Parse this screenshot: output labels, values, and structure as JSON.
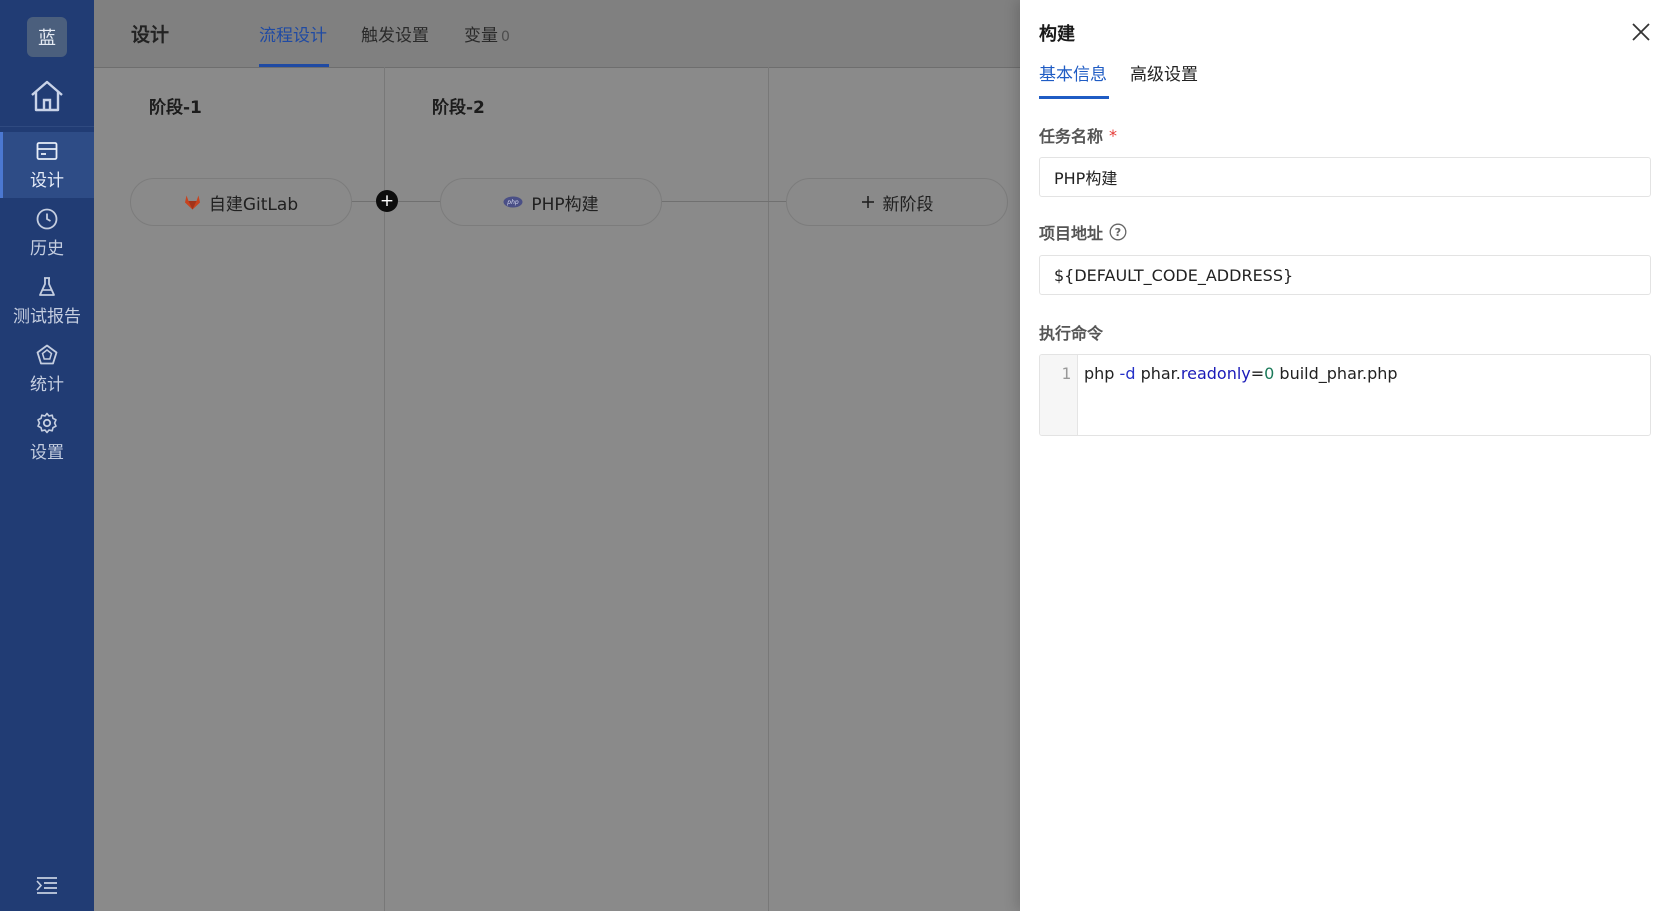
{
  "app": {
    "logo_text": "蓝"
  },
  "sidebar": {
    "items": [
      {
        "label": "设计",
        "icon": "card-icon",
        "active": true
      },
      {
        "label": "历史",
        "icon": "clock-icon",
        "active": false
      },
      {
        "label": "测试报告",
        "icon": "flask-icon",
        "active": false
      },
      {
        "label": "统计",
        "icon": "pentagon-chart-icon",
        "active": false
      },
      {
        "label": "设置",
        "icon": "gear-icon",
        "active": false
      }
    ]
  },
  "main": {
    "title": "设计",
    "tabs": [
      {
        "label": "流程设计",
        "active": true
      },
      {
        "label": "触发设置",
        "active": false
      },
      {
        "label": "变量",
        "count": "0",
        "active": false
      }
    ],
    "stages": [
      {
        "title": "阶段-1",
        "task": "自建GitLab",
        "icon": "gitlab-icon"
      },
      {
        "title": "阶段-2",
        "task": "PHP构建",
        "icon": "php-icon"
      }
    ],
    "new_stage_label": "新阶段"
  },
  "drawer": {
    "title": "构建",
    "tabs": [
      {
        "label": "基本信息",
        "active": true
      },
      {
        "label": "高级设置",
        "active": false
      }
    ],
    "fields": {
      "task_name": {
        "label": "任务名称",
        "required_mark": "*",
        "value": "PHP构建"
      },
      "project_address": {
        "label": "项目地址",
        "value": "${DEFAULT_CODE_ADDRESS}"
      },
      "command": {
        "label": "执行命令",
        "line_number": "1",
        "tokens": [
          "php ",
          "-d",
          " phar.",
          "readonly",
          "=",
          "0",
          " build_phar.php"
        ]
      }
    }
  },
  "colors": {
    "sidebar_bg": "#213c74",
    "accent": "#1f5cc4",
    "overlay": "#8a8a8a",
    "required": "#e53935"
  }
}
